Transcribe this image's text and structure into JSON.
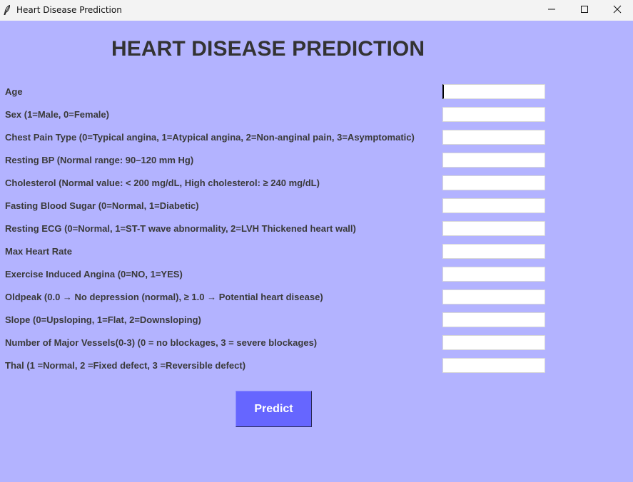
{
  "window": {
    "title": "Heart Disease Prediction",
    "controls": {
      "minimize_icon": "minimize-icon",
      "maximize_icon": "maximize-icon",
      "close_icon": "close-icon"
    },
    "app_icon": "feather-icon"
  },
  "colors": {
    "background": "#b3b3ff",
    "heading": "#333333",
    "button_bg": "#6666ff",
    "button_text": "#ffffff"
  },
  "heading": "HEART DISEASE PREDICTION",
  "fields": [
    {
      "label": "Age",
      "value": ""
    },
    {
      "label": "Sex (1=Male, 0=Female)",
      "value": ""
    },
    {
      "label": "Chest Pain Type (0=Typical angina, 1=Atypical angina, 2=Non-anginal pain, 3=Asymptomatic)",
      "value": ""
    },
    {
      "label": "Resting BP (Normal range: 90–120 mm Hg)",
      "value": ""
    },
    {
      "label": "Cholesterol (Normal value: < 200 mg/dL, High cholesterol: ≥ 240 mg/dL)",
      "value": ""
    },
    {
      "label": "Fasting Blood Sugar (0=Normal, 1=Diabetic)",
      "value": ""
    },
    {
      "label": "Resting ECG (0=Normal, 1=ST-T wave abnormality, 2=LVH Thickened heart wall)",
      "value": ""
    },
    {
      "label": "Max Heart Rate",
      "value": ""
    },
    {
      "label": "Exercise Induced Angina (0=NO, 1=YES)",
      "value": ""
    },
    {
      "label": "Oldpeak (0.0 → No depression (normal), ≥ 1.0 → Potential heart disease)",
      "value": ""
    },
    {
      "label": "Slope (0=Upsloping, 1=Flat, 2=Downsloping)",
      "value": ""
    },
    {
      "label": "Number of Major Vessels(0-3) (0 = no blockages, 3 = severe blockages)",
      "value": ""
    },
    {
      "label": "Thal (1 =Normal, 2 =Fixed defect, 3 =Reversible defect)",
      "value": ""
    }
  ],
  "predict_button": {
    "label": "Predict"
  }
}
